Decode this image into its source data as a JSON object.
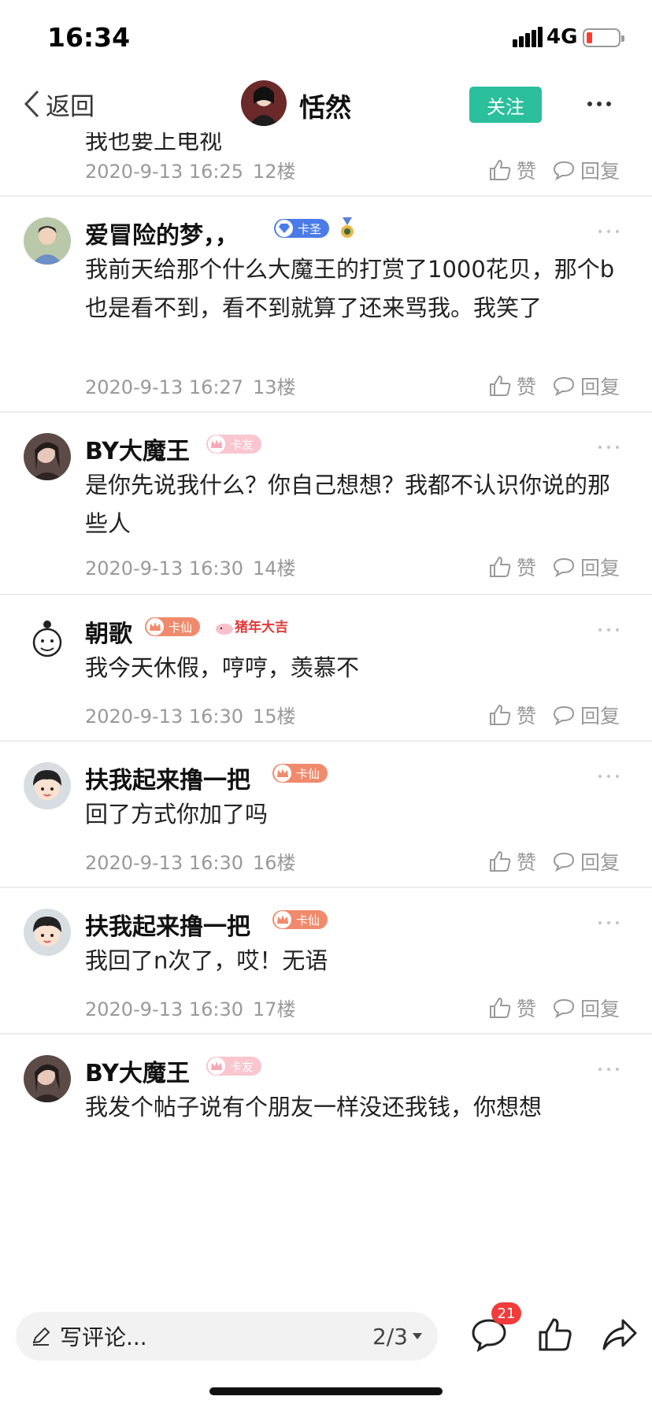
{
  "status": {
    "time": "16:34",
    "network": "4G"
  },
  "nav": {
    "back_label": "返回",
    "title": "恬然",
    "follow_label": "关注"
  },
  "partial": {
    "text": "我也要上电视",
    "date": "2020-9-13 16:25",
    "floor": "12楼"
  },
  "labels": {
    "like": "赞",
    "reply": "回复"
  },
  "comments": [
    {
      "name": "爱冒险的梦，，",
      "badge": "卡圣",
      "badge_color": "#4a7be8",
      "text": "我前天给那个什么大魔王的打赏了1000花贝，那个b也是看不到，看不到就算了还来骂我。我笑了",
      "date": "2020-9-13 16:27",
      "floor": "13楼"
    },
    {
      "name": "BY大魔王",
      "badge": "卡友",
      "badge_color": "#f9c6cf",
      "text": "是你先说我什么？你自己想想？我都不认识你说的那些人",
      "date": "2020-9-13 16:30",
      "floor": "14楼"
    },
    {
      "name": "朝歌",
      "badge": "卡仙",
      "badge_color": "#f08a6c",
      "fest": "猪年大吉",
      "text": "我今天休假，哼哼，羡慕不",
      "date": "2020-9-13 16:30",
      "floor": "15楼"
    },
    {
      "name": "扶我起来撸一把",
      "badge": "卡仙",
      "badge_color": "#f08a6c",
      "text": "回了方式你加了吗",
      "date": "2020-9-13 16:30",
      "floor": "16楼"
    },
    {
      "name": "扶我起来撸一把",
      "badge": "卡仙",
      "badge_color": "#f08a6c",
      "text": "我回了n次了，哎！无语",
      "date": "2020-9-13 16:30",
      "floor": "17楼"
    },
    {
      "name": "BY大魔王",
      "badge": "卡友",
      "badge_color": "#f9c6cf",
      "text": "我发个帖子说有个朋友一样没还我钱，你想想"
    }
  ],
  "bottom": {
    "placeholder": "写评论...",
    "page": "2/3",
    "comment_count": "21"
  },
  "icons": [
    "chevron-left-icon",
    "more-icon",
    "thumb-up-icon",
    "reply-icon",
    "pencil-icon",
    "comment-icon",
    "share-icon"
  ]
}
